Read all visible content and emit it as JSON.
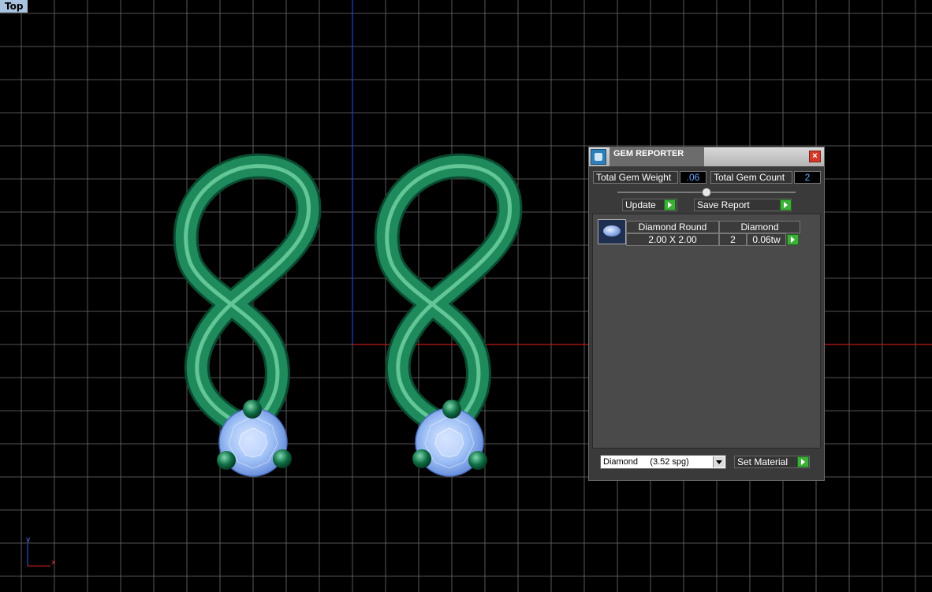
{
  "viewport": {
    "view_name": "Top",
    "grid_color": "#6e6e6e",
    "x_axis_color": "#c01818",
    "y_axis_color": "#2040d0",
    "metal_color": "#1f8a5c",
    "gem_color": "#8fb4f2"
  },
  "gem_reporter": {
    "title": "GEM REPORTER",
    "total_weight_label": "Total Gem Weight",
    "total_weight_value": ".06",
    "total_count_label": "Total Gem Count",
    "total_count_value": "2",
    "update_label": "Update",
    "save_report_label": "Save Report",
    "gems": [
      {
        "shape": "Diamond Round",
        "size": "2.00 X 2.00",
        "material": "Diamond",
        "count": "2",
        "weight": "0.06tw"
      }
    ],
    "material_select_value": "Diamond     (3.52 spg)",
    "set_material_label": "Set Material"
  },
  "axis_icon": {
    "x_label": "x",
    "y_label": "y"
  }
}
